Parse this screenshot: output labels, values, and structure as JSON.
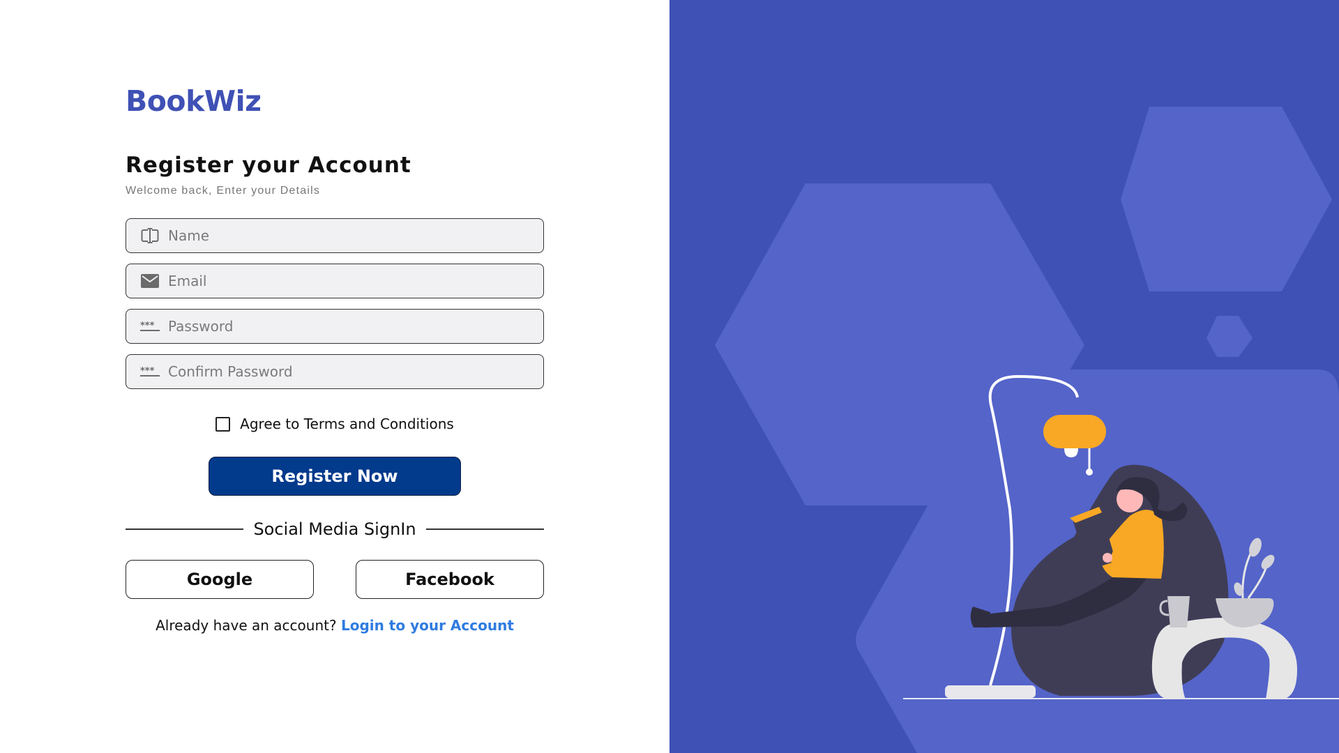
{
  "brand": {
    "name": "BookWiz",
    "color": "#3f51b5"
  },
  "header": {
    "title": "Register your Account",
    "subtitle": "Welcome back, Enter your Details"
  },
  "form": {
    "name": {
      "placeholder": "Name",
      "icon": "text-cursor-icon"
    },
    "email": {
      "placeholder": "Email",
      "icon": "envelope-icon"
    },
    "password": {
      "placeholder": "Password",
      "icon": "password-dots-icon"
    },
    "confirm_password": {
      "placeholder": "Confirm Password",
      "icon": "password-dots-icon"
    },
    "terms_label": "Agree to Terms and Conditions",
    "register_label": "Register Now"
  },
  "social": {
    "divider_label": "Social Media SignIn",
    "google_label": "Google",
    "facebook_label": "Facebook"
  },
  "login": {
    "prompt": "Already have an account?",
    "link_label": "Login to your Account"
  },
  "colors": {
    "primary_button": "#023a8c",
    "link": "#2f7ce0",
    "panel_bg": "#3f51b5",
    "accent_lamp": "#f9a825"
  },
  "illustration": {
    "name": "woman-reading-in-beanbag-illustration"
  }
}
